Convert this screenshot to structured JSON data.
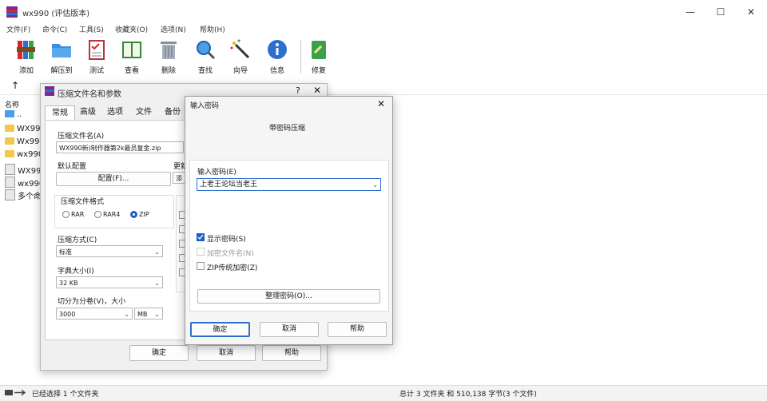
{
  "window": {
    "title": "wx990 (评估版本)",
    "controls": [
      "—",
      "☐",
      "✕"
    ]
  },
  "menu": [
    "文件(F)",
    "命令(C)",
    "工具(S)",
    "收藏夹(O)",
    "选项(N)",
    "帮助(H)"
  ],
  "toolbar": [
    {
      "label": "添加",
      "icon": "archive-books-icon"
    },
    {
      "label": "解压到",
      "icon": "folder-extract-icon"
    },
    {
      "label": "测试",
      "icon": "checklist-icon"
    },
    {
      "label": "查看",
      "icon": "book-view-icon"
    },
    {
      "label": "删除",
      "icon": "trash-icon"
    },
    {
      "label": "查找",
      "icon": "magnifier-icon"
    },
    {
      "label": "向导",
      "icon": "magic-wand-icon"
    },
    {
      "label": "信息",
      "icon": "info-icon"
    },
    {
      "label": "修复",
      "icon": "repair-icon"
    }
  ],
  "filelist": {
    "up": "↑",
    "column_name": "名称",
    "rows": [
      {
        "name": "..",
        "type": "drive"
      },
      {
        "name": "WX99",
        "type": "folder"
      },
      {
        "name": "Wx99",
        "type": "folder"
      },
      {
        "name": "wx990",
        "type": "folder"
      },
      {
        "name": "WX99",
        "type": "file"
      },
      {
        "name": "wx990",
        "type": "file"
      },
      {
        "name": "多个命",
        "type": "file"
      }
    ]
  },
  "status": {
    "left": "已经选择 1 个文件夹",
    "right": "总计 3 文件夹 和 510,138 字节(3 个文件)"
  },
  "archive_dialog": {
    "title": "压缩文件名和参数",
    "help": "?",
    "close": "✕",
    "tabs": [
      "常规",
      "高级",
      "选项",
      "文件",
      "备份"
    ],
    "archive_name_label": "压缩文件名(A)",
    "archive_name_value": "WX990新)制作器第2k最员复金.zip",
    "default_profile_label": "默认配置",
    "profile_button": "配置(F)...",
    "update_label": "更新",
    "update_value": "添",
    "format_label": "压缩文件格式",
    "formats": [
      "RAR",
      "RAR4",
      "ZIP"
    ],
    "format_selected": "ZIP",
    "method_label": "压缩方式(C)",
    "method_value": "标准",
    "dict_label": "字典大小(I)",
    "dict_value": "32 KB",
    "split_label": "切分为分卷(V)，大小",
    "split_value": "3000",
    "split_unit": "MB",
    "ok": "确定",
    "cancel": "取消",
    "help_btn": "帮助"
  },
  "password_dialog": {
    "title": "输入密码",
    "close": "✕",
    "subtitle": "带密码压缩",
    "enter_label": "输入密码(E)",
    "password_value": "上老王论坛当老王",
    "show_password": "显示密码(S)",
    "show_password_checked": true,
    "encrypt_names": "加密文件名(N)",
    "encrypt_names_checked": false,
    "zip_legacy": "ZIP传统加密(Z)",
    "zip_legacy_checked": false,
    "organize_button": "整理密码(O)...",
    "ok": "确定",
    "cancel": "取消",
    "help_btn": "帮助"
  }
}
